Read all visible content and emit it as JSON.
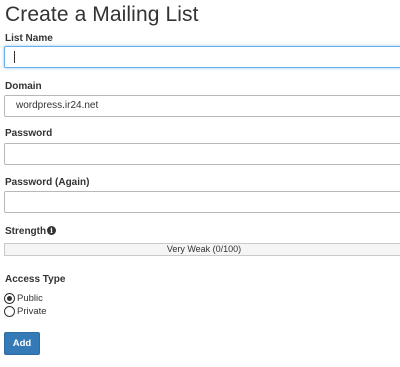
{
  "page": {
    "title": "Create a Mailing List"
  },
  "form": {
    "list_name": {
      "label": "List Name",
      "value": ""
    },
    "domain": {
      "label": "Domain",
      "value": "wordpress.ir24.net"
    },
    "password": {
      "label": "Password",
      "value": ""
    },
    "password_again": {
      "label": "Password (Again)",
      "value": ""
    },
    "strength": {
      "label": "Strength",
      "icon": "info-icon",
      "text": "Very Weak (0/100)",
      "score": 0,
      "max": 100
    },
    "access_type": {
      "label": "Access Type",
      "options": [
        {
          "label": "Public",
          "checked": true
        },
        {
          "label": "Private",
          "checked": false
        }
      ]
    },
    "submit_label": "Add"
  },
  "colors": {
    "primary": "#337ab7",
    "focus_border": "#66afe9",
    "text": "#333333"
  }
}
